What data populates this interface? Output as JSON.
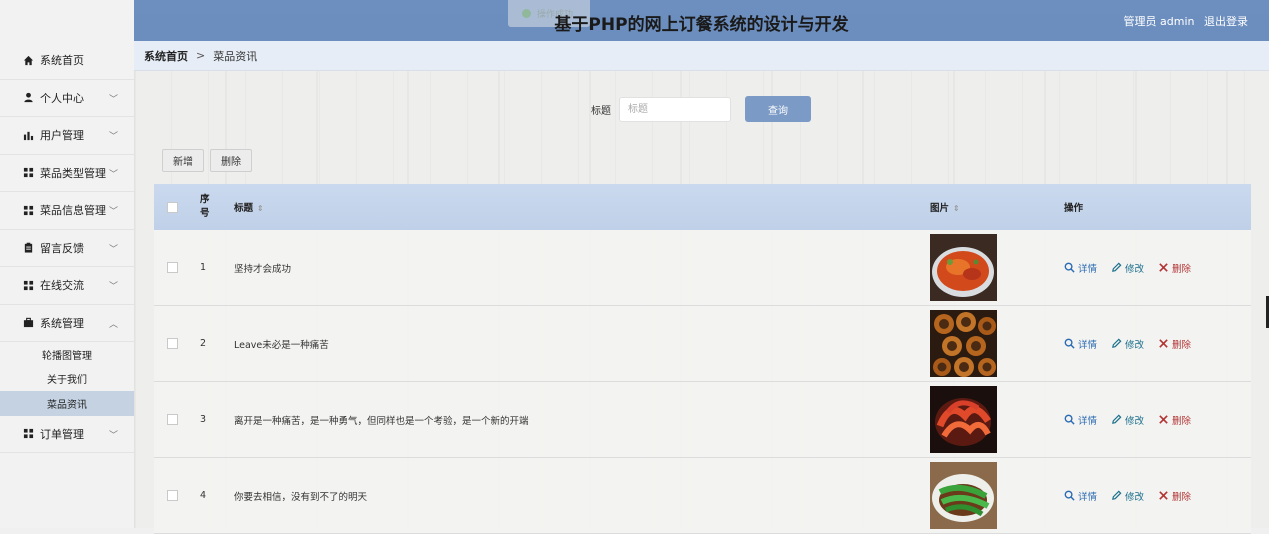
{
  "header": {
    "title": "基于PHP的网上订餐系统的设计与开发",
    "user_label": "管理员 admin",
    "logout_label": "退出登录",
    "toast_text": "操作成功"
  },
  "sidebar": {
    "items": [
      {
        "label": "系统首页",
        "icon": "home-icon"
      },
      {
        "label": "个人中心",
        "icon": "user-icon"
      },
      {
        "label": "用户管理",
        "icon": "bar-chart-icon"
      },
      {
        "label": "菜品类型管理",
        "icon": "grid-icon"
      },
      {
        "label": "菜品信息管理",
        "icon": "grid-icon"
      },
      {
        "label": "留言反馈",
        "icon": "clipboard-icon"
      },
      {
        "label": "在线交流",
        "icon": "grid-icon"
      },
      {
        "label": "系统管理",
        "icon": "briefcase-icon"
      },
      {
        "label": "订单管理",
        "icon": "grid-icon"
      }
    ],
    "sub_items": [
      {
        "label": "轮播图管理"
      },
      {
        "label": "关于我们"
      },
      {
        "label": "菜品资讯"
      }
    ]
  },
  "breadcrumb": {
    "home": "系统首页",
    "separator": ">",
    "current": "菜品资讯"
  },
  "search": {
    "label": "标题",
    "placeholder": "标题",
    "value": "",
    "button": "查询"
  },
  "toolbar": {
    "add_label": "新增",
    "delete_label": "删除"
  },
  "table": {
    "columns": {
      "index": "序号",
      "title": "标题",
      "image": "图片",
      "actions": "操作"
    },
    "action_labels": {
      "detail": "详情",
      "edit": "修改",
      "delete": "删除"
    },
    "rows": [
      {
        "index": "1",
        "title": "坚持才会成功"
      },
      {
        "index": "2",
        "title": "Leave未必是一种痛苦"
      },
      {
        "index": "3",
        "title": "离开是一种痛苦，是一种勇气，但同样也是一个考验，是一个新的开端"
      },
      {
        "index": "4",
        "title": "你要去相信，没有到不了的明天"
      }
    ]
  },
  "colors": {
    "header_bg": "#6c8ebe",
    "query_button": "#7b9ac5",
    "table_head": "#c4d4ea",
    "active_sub": "#c4d2e2"
  }
}
